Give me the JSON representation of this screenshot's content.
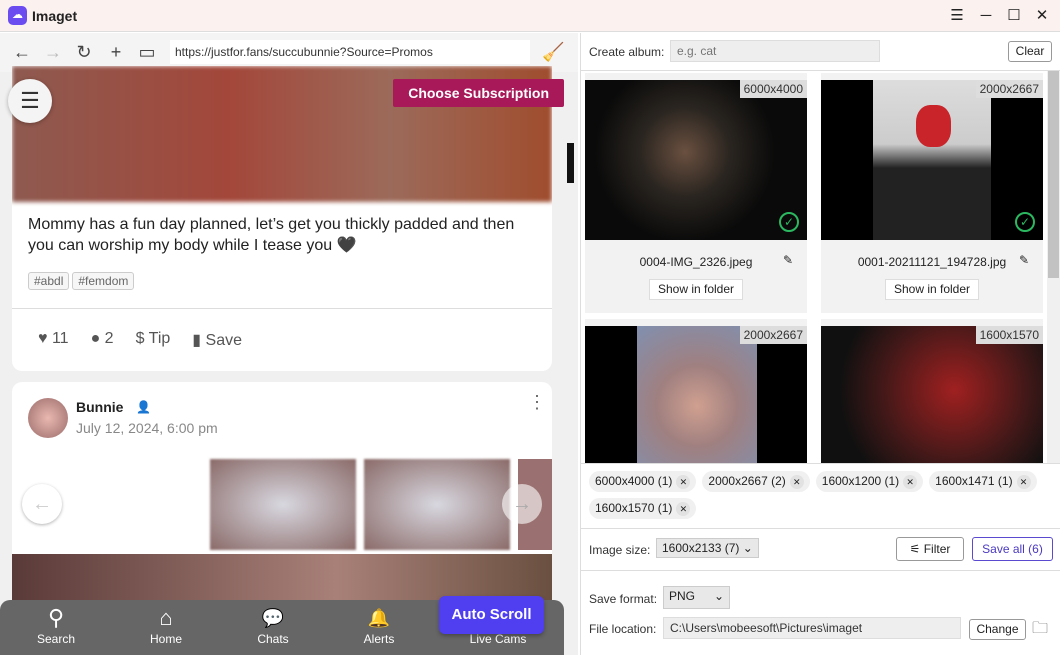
{
  "app": {
    "title": "Imaget",
    "accent": "#6a4cf0"
  },
  "window": {
    "menu_icon": "☰",
    "minimize_icon": "─",
    "maximize_icon": "☐",
    "close_icon": "✕"
  },
  "browser": {
    "url": "https://justfor.fans/succubunnie?Source=Promos"
  },
  "post1": {
    "subscribe_label": "Choose Subscription",
    "text": "Mommy has a fun day planned, let’s get you thickly padded and then you can worship my body while I tease you 🖤",
    "tags": [
      "#abdl",
      "#femdom"
    ],
    "likes": "11",
    "comments": "2",
    "tip_label": "Tip",
    "save_label": "Save"
  },
  "post2": {
    "author": "Bunnie",
    "date": "July 12, 2024, 6:00 pm"
  },
  "bottom_nav": [
    {
      "label": "Search",
      "icon": "⚲"
    },
    {
      "label": "Home",
      "icon": "⌂"
    },
    {
      "label": "Chats",
      "icon": "💬"
    },
    {
      "label": "Alerts",
      "icon": "🔔"
    },
    {
      "label": "Live Cams",
      "icon": ""
    }
  ],
  "auto_scroll_label": "Auto Scroll",
  "album": {
    "label": "Create album:",
    "placeholder": "e.g. cat",
    "clear_label": "Clear"
  },
  "images": [
    {
      "dims": "6000x4000",
      "name": "0004-IMG_2326.jpeg",
      "show_label": "Show in folder",
      "selected": true
    },
    {
      "dims": "2000x2667",
      "name": "0001-20211121_194728.jpg",
      "show_label": "Show in folder",
      "selected": true
    },
    {
      "dims": "2000x2667",
      "selected": true
    },
    {
      "dims": "1600x1570",
      "selected": true
    }
  ],
  "chips": [
    "6000x4000 (1)",
    "2000x2667 (2)",
    "1600x1200 (1)",
    "1600x1471 (1)",
    "1600x1570 (1)"
  ],
  "image_size": {
    "label": "Image size:",
    "value": "1600x2133 (7)"
  },
  "filter_label": "Filter",
  "save_all_label": "Save all (6)",
  "save_format": {
    "label": "Save format:",
    "value": "PNG"
  },
  "file_location": {
    "label": "File location:",
    "value": "C:\\Users\\mobeesoft\\Pictures\\imaget",
    "change_label": "Change"
  }
}
